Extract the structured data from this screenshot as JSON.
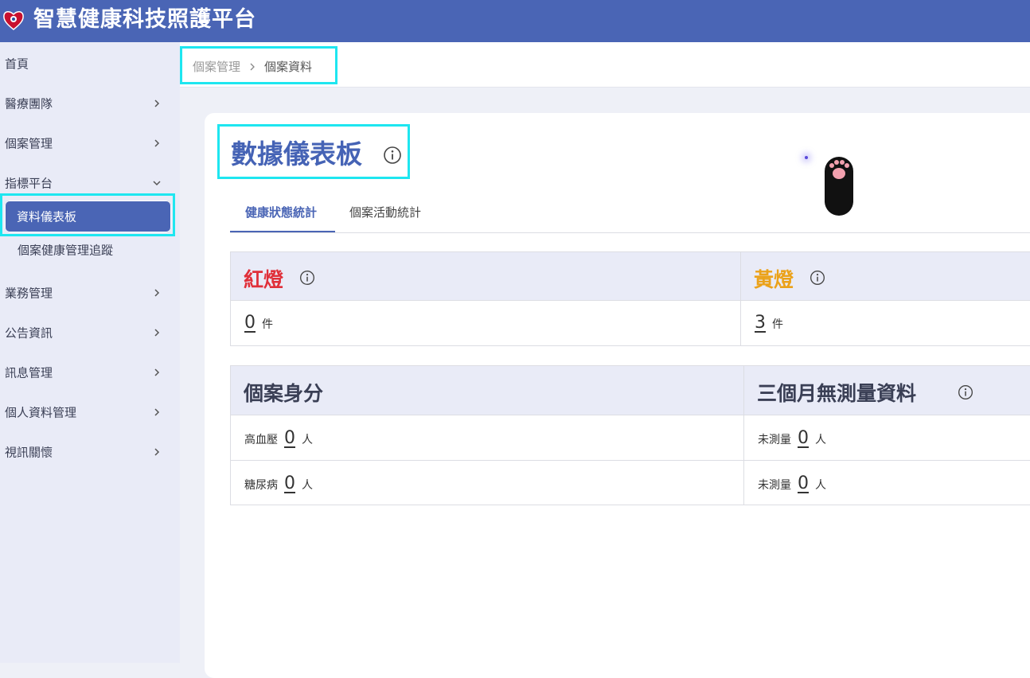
{
  "header": {
    "title": "智慧健康科技照護平台"
  },
  "sidebar": {
    "items": [
      {
        "label": "首頁"
      },
      {
        "label": "醫療團隊"
      },
      {
        "label": "個案管理"
      },
      {
        "label": "指標平台"
      },
      {
        "label": "資料儀表板"
      },
      {
        "label": "個案健康管理追蹤"
      },
      {
        "label": "業務管理"
      },
      {
        "label": "公告資訊"
      },
      {
        "label": "訊息管理"
      },
      {
        "label": "個人資料管理"
      },
      {
        "label": "視訊關懷"
      }
    ]
  },
  "breadcrumb": {
    "parent": "個案管理",
    "current": "個案資料"
  },
  "page": {
    "title": "數據儀表板"
  },
  "tabs": [
    {
      "label": "健康狀態統計"
    },
    {
      "label": "個案活動統計"
    }
  ],
  "lights": {
    "red": {
      "title": "紅燈",
      "count": "0",
      "unit": "件",
      "color": "#e0303a"
    },
    "yellow": {
      "title": "黃燈",
      "count": "3",
      "unit": "件",
      "color": "#eba21a"
    }
  },
  "identity": {
    "title": "個案身分",
    "rows": [
      {
        "label": "高血壓",
        "count": "0",
        "unit": "人"
      },
      {
        "label": "糖尿病",
        "count": "0",
        "unit": "人"
      }
    ]
  },
  "no_measure": {
    "title": "三個月無測量資料",
    "rows": [
      {
        "label": "未測量",
        "count": "0",
        "unit": "人"
      },
      {
        "label": "未測量",
        "count": "0",
        "unit": "人"
      }
    ]
  },
  "colors": {
    "brand": "#4a65b5",
    "highlight": "#1ee6f0"
  }
}
